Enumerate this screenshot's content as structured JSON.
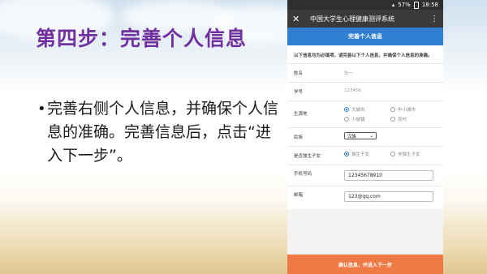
{
  "slide": {
    "title": "第四步：完善个人信息",
    "bullet_symbol": "•",
    "bullet_text": "完善右侧个人信息，并确保个人信息的准确。完善信息后，点击“进入下一步”。",
    "title_color": "#7030a0"
  },
  "phone": {
    "status": {
      "battery": "57%",
      "time": "18:58"
    },
    "appbar": {
      "close": "✕",
      "title": "中国大学生心理健康测评系统",
      "more": "⋮"
    },
    "banner": "完善个人信息",
    "notice": "以下信息均为必填项，请完善以下个人信息，并确保个人信息的准确。",
    "form": {
      "name": {
        "label": "姓名",
        "value": "张一"
      },
      "id": {
        "label": "学号",
        "value": "123456"
      },
      "origin": {
        "label": "生源地",
        "options": [
          "大城市",
          "中小城市",
          "小城镇",
          "农村"
        ],
        "selected": "大城市"
      },
      "ethnicity": {
        "label": "民族",
        "value": "汉族"
      },
      "only_child": {
        "label": "是否独生子女",
        "options": [
          "独生子女",
          "非独生子女"
        ],
        "selected": "独生子女"
      },
      "phone": {
        "label": "手机号码",
        "value": "12345678910"
      },
      "email": {
        "label": "邮箱",
        "value": "123@qq.com"
      }
    },
    "submit": "确认信息，并进入下一步",
    "accent": "#2f7fd3",
    "submit_color": "#ee7a45"
  }
}
